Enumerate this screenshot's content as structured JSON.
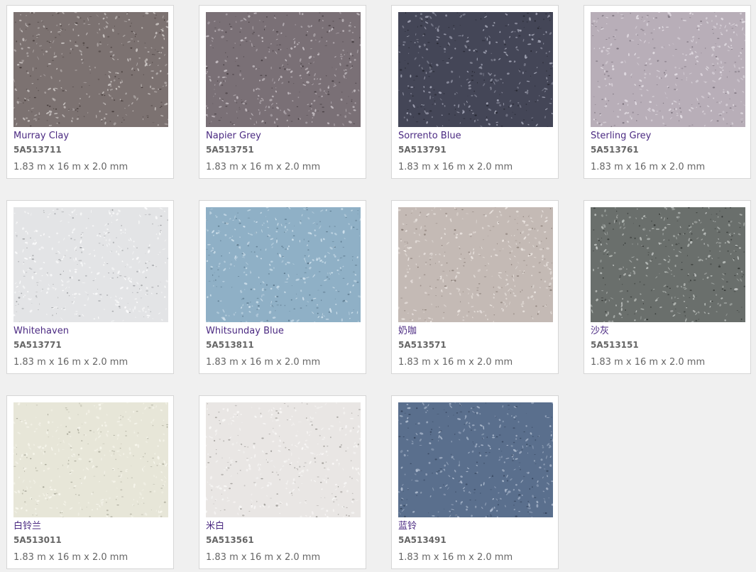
{
  "products": [
    {
      "name": "Murray Clay",
      "code": "5A513711",
      "dims": "1.83 m x 16 m x 2.0 mm",
      "color_base": "#7c7271",
      "color_light": "#d4cfcd",
      "color_dark": "#3a302f"
    },
    {
      "name": "Napier Grey",
      "code": "5A513751",
      "dims": "1.83 m x 16 m x 2.0 mm",
      "color_base": "#7a7076",
      "color_light": "#cdc6cb",
      "color_dark": "#3b3337"
    },
    {
      "name": "Sorrento Blue",
      "code": "5A513791",
      "dims": "1.83 m x 16 m x 2.0 mm",
      "color_base": "#444657",
      "color_light": "#b4b6c6",
      "color_dark": "#1f2029"
    },
    {
      "name": "Sterling Grey",
      "code": "5A513761",
      "dims": "1.83 m x 16 m x 2.0 mm",
      "color_base": "#b8aeb8",
      "color_light": "#e9e4ea",
      "color_dark": "#6e6570"
    },
    {
      "name": "Whitehaven",
      "code": "5A513771",
      "dims": "1.83 m x 16 m x 2.0 mm",
      "color_base": "#e3e4e6",
      "color_light": "#ffffff",
      "color_dark": "#8a8c90"
    },
    {
      "name": "Whitsunday Blue",
      "code": "5A513811",
      "dims": "1.83 m x 16 m x 2.0 mm",
      "color_base": "#8fb0c6",
      "color_light": "#d7e6f0",
      "color_dark": "#4f6b7f"
    },
    {
      "name": "奶咖",
      "code": "5A513571",
      "dims": "1.83 m x 16 m x 2.0 mm",
      "color_base": "#c4bab5",
      "color_light": "#efe9e5",
      "color_dark": "#7a6d66"
    },
    {
      "name": "沙灰",
      "code": "5A513151",
      "dims": "1.83 m x 16 m x 2.0 mm",
      "color_base": "#6a6f6c",
      "color_light": "#c9cdca",
      "color_dark": "#262927"
    },
    {
      "name": "白铃兰",
      "code": "5A513011",
      "dims": "1.83 m x 16 m x 2.0 mm",
      "color_base": "#e7e6d8",
      "color_light": "#faf9f0",
      "color_dark": "#9a998a"
    },
    {
      "name": "米白",
      "code": "5A513561",
      "dims": "1.83 m x 16 m x 2.0 mm",
      "color_base": "#e9e6e4",
      "color_light": "#fbfaf9",
      "color_dark": "#8d8a86"
    },
    {
      "name": "蓝铃",
      "code": "5A513491",
      "dims": "1.83 m x 16 m x 2.0 mm",
      "color_base": "#5a6f8d",
      "color_light": "#b8c4d6",
      "color_dark": "#2d3b52"
    }
  ]
}
